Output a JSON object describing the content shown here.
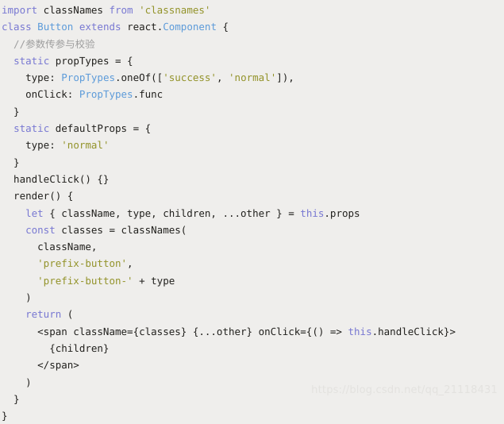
{
  "editor": {
    "language": "jsx",
    "background_color": "#efeeec",
    "default_text_color": "#21201d",
    "theme_colors": {
      "keyword": "#7878d2",
      "string": "#93932a",
      "comment": "#9e9e9e",
      "type": "#5d9bd9",
      "plain": "#21201d",
      "watermark": "#e3e2df"
    },
    "lines": [
      [
        {
          "t": "import",
          "c": "kw"
        },
        {
          "t": " classNames ",
          "c": "pln"
        },
        {
          "t": "from",
          "c": "kw"
        },
        {
          "t": " ",
          "c": "pln"
        },
        {
          "t": "'classnames'",
          "c": "str"
        }
      ],
      [
        {
          "t": "class",
          "c": "kw"
        },
        {
          "t": " ",
          "c": "pln"
        },
        {
          "t": "Button",
          "c": "typ"
        },
        {
          "t": " ",
          "c": "pln"
        },
        {
          "t": "extends",
          "c": "kw"
        },
        {
          "t": " react.",
          "c": "pln"
        },
        {
          "t": "Component",
          "c": "typ"
        },
        {
          "t": " {",
          "c": "pln"
        }
      ],
      [
        {
          "t": "  //参数传参与校验",
          "c": "cmt"
        }
      ],
      [
        {
          "t": "  ",
          "c": "pln"
        },
        {
          "t": "static",
          "c": "kw"
        },
        {
          "t": " propTypes = {",
          "c": "pln"
        }
      ],
      [
        {
          "t": "    type: ",
          "c": "pln"
        },
        {
          "t": "PropTypes",
          "c": "typ"
        },
        {
          "t": ".oneOf([",
          "c": "pln"
        },
        {
          "t": "'success'",
          "c": "str"
        },
        {
          "t": ", ",
          "c": "pln"
        },
        {
          "t": "'normal'",
          "c": "str"
        },
        {
          "t": "]),",
          "c": "pln"
        }
      ],
      [
        {
          "t": "    onClick: ",
          "c": "pln"
        },
        {
          "t": "PropTypes",
          "c": "typ"
        },
        {
          "t": ".func",
          "c": "pln"
        }
      ],
      [
        {
          "t": "  }",
          "c": "pln"
        }
      ],
      [
        {
          "t": "  ",
          "c": "pln"
        },
        {
          "t": "static",
          "c": "kw"
        },
        {
          "t": " defaultProps = {",
          "c": "pln"
        }
      ],
      [
        {
          "t": "    type: ",
          "c": "pln"
        },
        {
          "t": "'normal'",
          "c": "str"
        }
      ],
      [
        {
          "t": "  }",
          "c": "pln"
        }
      ],
      [
        {
          "t": "  handleClick() {}",
          "c": "pln"
        }
      ],
      [
        {
          "t": "  render() {",
          "c": "pln"
        }
      ],
      [
        {
          "t": "    ",
          "c": "pln"
        },
        {
          "t": "let",
          "c": "kw"
        },
        {
          "t": " { className, type, children, ...other } = ",
          "c": "pln"
        },
        {
          "t": "this",
          "c": "kw"
        },
        {
          "t": ".props",
          "c": "pln"
        }
      ],
      [
        {
          "t": "    ",
          "c": "pln"
        },
        {
          "t": "const",
          "c": "kw"
        },
        {
          "t": " classes = classNames(",
          "c": "pln"
        }
      ],
      [
        {
          "t": "      className,",
          "c": "pln"
        }
      ],
      [
        {
          "t": "      ",
          "c": "pln"
        },
        {
          "t": "'prefix-button'",
          "c": "str"
        },
        {
          "t": ",",
          "c": "pln"
        }
      ],
      [
        {
          "t": "      ",
          "c": "pln"
        },
        {
          "t": "'prefix-button-'",
          "c": "str"
        },
        {
          "t": " + type",
          "c": "pln"
        }
      ],
      [
        {
          "t": "    )",
          "c": "pln"
        }
      ],
      [
        {
          "t": "    ",
          "c": "pln"
        },
        {
          "t": "return",
          "c": "kw"
        },
        {
          "t": " (",
          "c": "pln"
        }
      ],
      [
        {
          "t": "      <span className={classes} {...other} onClick={() => ",
          "c": "pln"
        },
        {
          "t": "this",
          "c": "kw"
        },
        {
          "t": ".handleClick}>",
          "c": "pln"
        }
      ],
      [
        {
          "t": "        {children}",
          "c": "pln"
        }
      ],
      [
        {
          "t": "      </span>",
          "c": "pln"
        }
      ],
      [
        {
          "t": "    )",
          "c": "pln"
        }
      ],
      [
        {
          "t": "  }",
          "c": "pln"
        }
      ],
      [
        {
          "t": "}",
          "c": "pln"
        }
      ]
    ]
  },
  "watermark": {
    "text": "https://blog.csdn.net/qq_21118431"
  }
}
